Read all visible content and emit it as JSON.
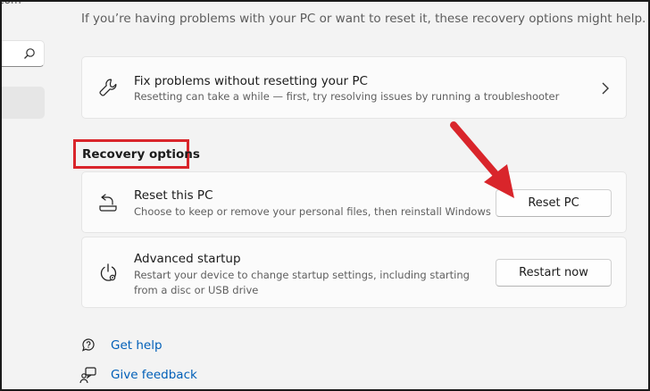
{
  "nav": {
    "email_fragment": "com",
    "search_icon": "search-icon"
  },
  "intro_text": "If you’re having problems with your PC or want to reset it, these recovery options might help.",
  "fix_card": {
    "icon": "wrench-icon",
    "title": "Fix problems without resetting your PC",
    "description": "Resetting can take a while — first, try resolving issues by running a troubleshooter",
    "chevron_icon": "chevron-right-icon"
  },
  "recovery_heading": "Recovery options",
  "reset_card": {
    "icon": "reset-pc-icon",
    "title": "Reset this PC",
    "description": "Choose to keep or remove your personal files, then reinstall Windows",
    "button_label": "Reset PC"
  },
  "advanced_card": {
    "icon": "advanced-startup-icon",
    "title": "Advanced startup",
    "description": "Restart your device to change startup settings, including starting from a disc or USB drive",
    "button_label": "Restart now"
  },
  "links": {
    "help_label": "Get help",
    "help_icon": "help-icon",
    "feedback_label": "Give feedback",
    "feedback_icon": "feedback-icon"
  },
  "colors": {
    "annotation_red": "#d9252b",
    "link_blue": "#005fb8",
    "background": "#f3f3f3",
    "card": "#fbfbfb"
  }
}
